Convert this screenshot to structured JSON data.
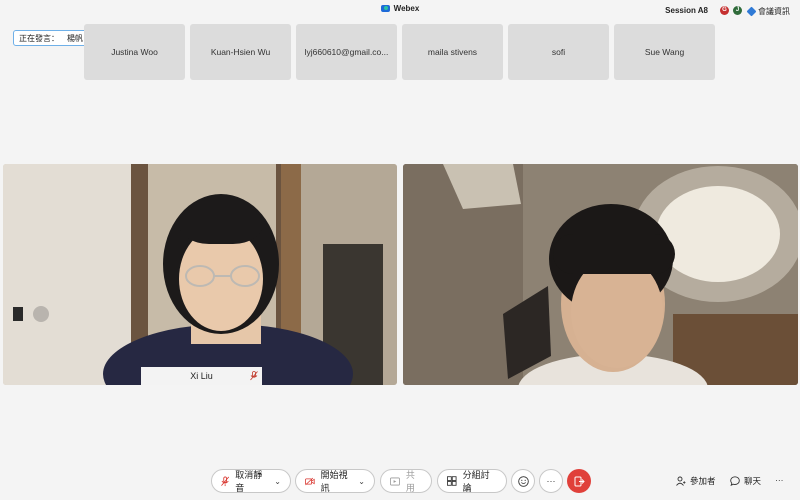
{
  "window": {
    "app_title": "Webex",
    "session": "Session A8",
    "avatar_1": "G",
    "avatar_2": "J",
    "meeting_info": "會議資訊"
  },
  "speaking": {
    "label": "正在發言：",
    "name": "楊帆"
  },
  "participants": [
    "Justina Woo",
    "Kuan-Hsien Wu",
    "lyj660610@gmail.co...",
    "maila stivens",
    "sofi",
    "Sue Wang"
  ],
  "videos": {
    "left_name": "Xi Liu"
  },
  "toolbar": {
    "mute_label": "取消靜音",
    "video_label": "開始視訊",
    "share_label": "共用",
    "breakout_label": "分組討論",
    "more_label": "···",
    "participants_label": "參加者",
    "chat_label": "聊天",
    "overflow_label": "···"
  },
  "colors": {
    "leave": "#e0403a",
    "speaking_border": "#6fb0e8",
    "tile": "#dcdcdc"
  }
}
